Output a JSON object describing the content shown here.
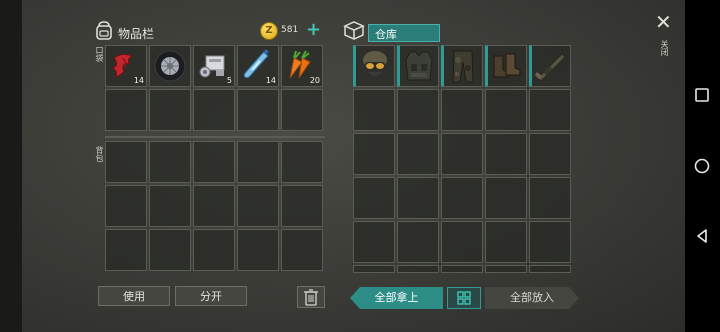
{
  "inventory": {
    "title": "物品栏",
    "coins": "581",
    "pocket_label": "口袋",
    "backpack_label": "背包",
    "pocket_slots": [
      {
        "icon": "red-cloth-icon",
        "count": "14"
      },
      {
        "icon": "tire-icon",
        "count": ""
      },
      {
        "icon": "scrap-parts-icon",
        "count": "5"
      },
      {
        "icon": "water-bottle-icon",
        "count": "14"
      },
      {
        "icon": "carrot-icon",
        "count": "20"
      }
    ]
  },
  "storage": {
    "title": "仓库",
    "equipment": [
      "gas-mask-helmet-icon",
      "tactical-vest-icon",
      "camo-pants-icon",
      "boots-icon",
      "rifle-icon"
    ]
  },
  "buttons": {
    "use": "使用",
    "split": "分开",
    "take_all": "全部拿上",
    "put_all": "全部放入",
    "close_label": "关闭"
  }
}
